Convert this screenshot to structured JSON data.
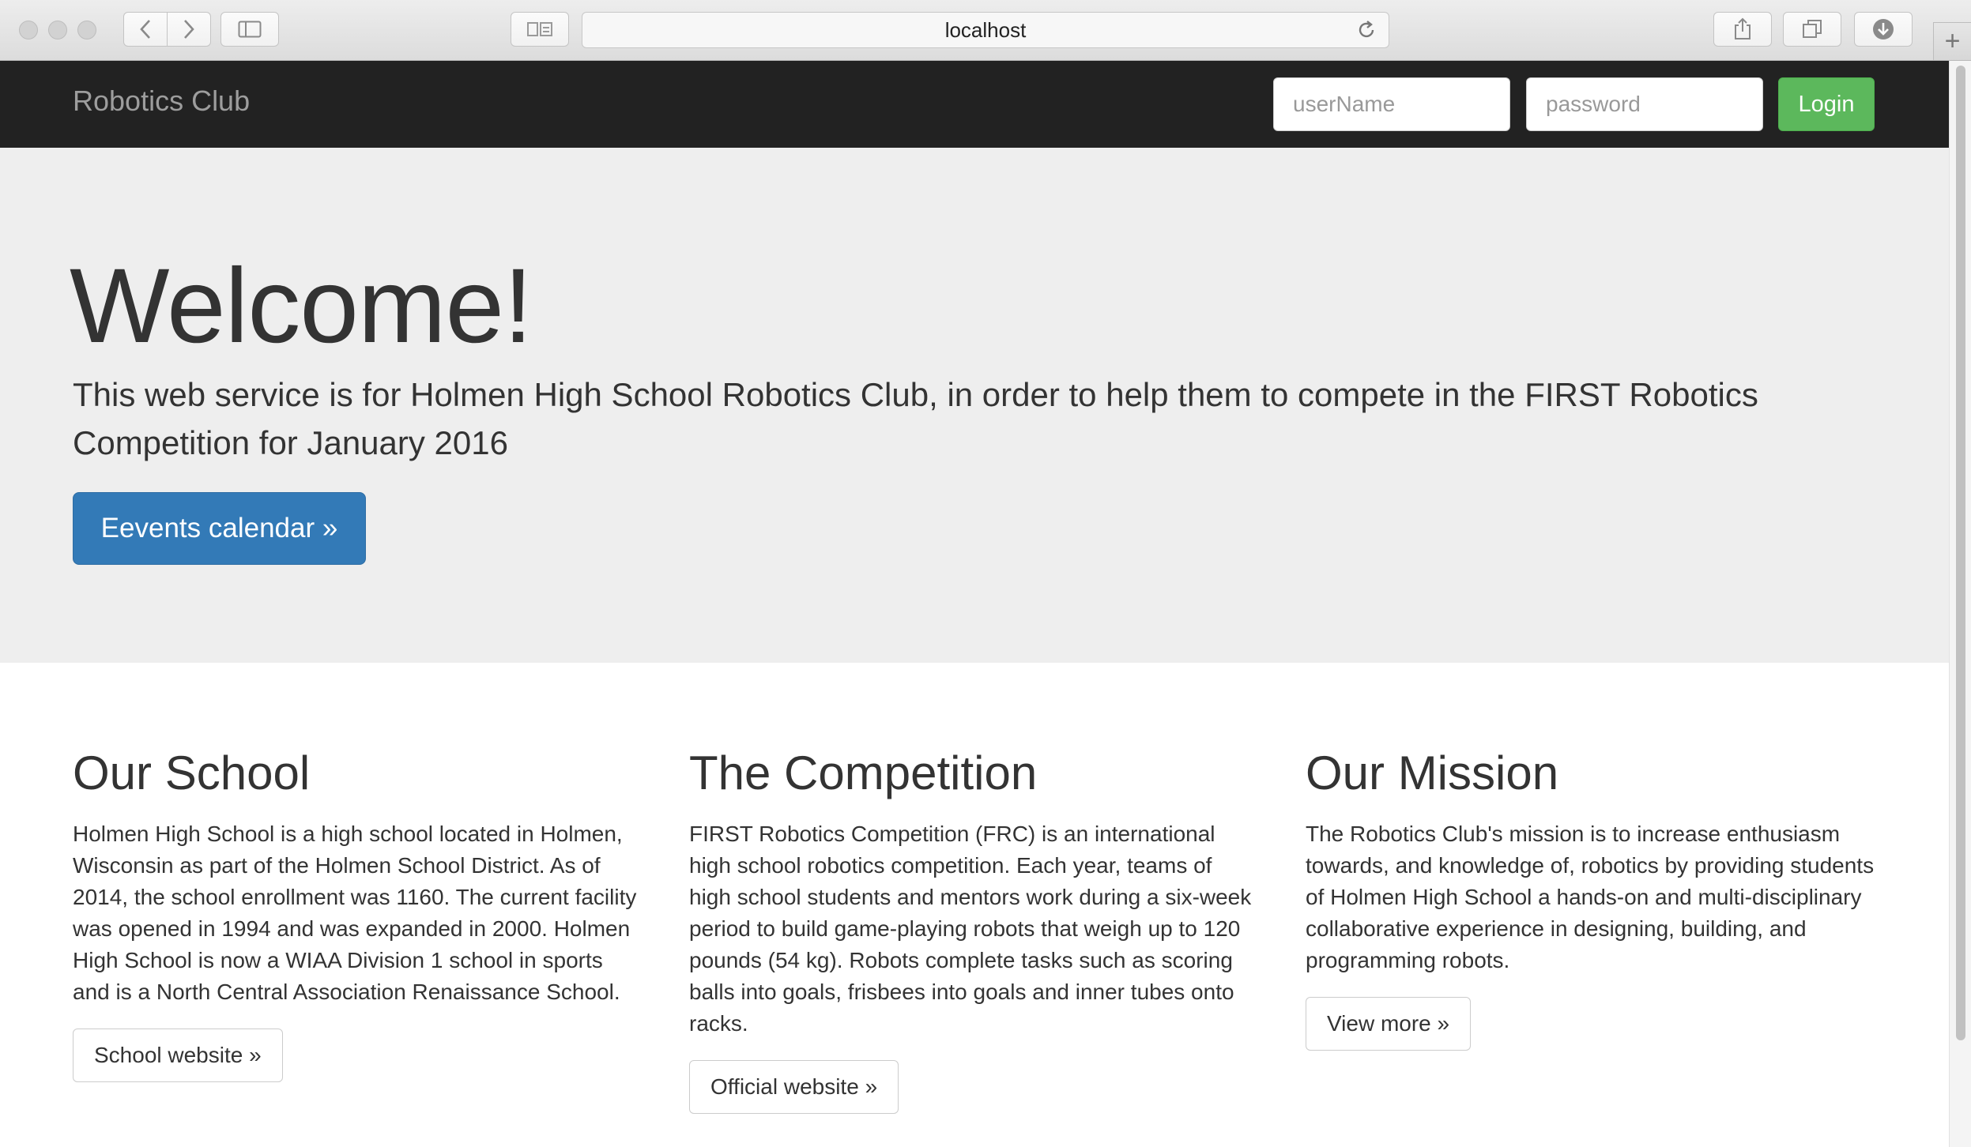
{
  "browser": {
    "url": "localhost",
    "translate_icon": "translate-icon",
    "colors": {
      "chrome": "#dcdcdc"
    }
  },
  "navbar": {
    "brand": "Robotics Club",
    "username_placeholder": "userName",
    "password_placeholder": "password",
    "login_label": "Login",
    "colors": {
      "background": "#222222",
      "login": "#5cb85c"
    }
  },
  "jumbotron": {
    "title": "Welcome!",
    "lead": "This web service is for Holmen High School Robotics Club, in order to help them to compete in the FIRST Robotics Competition for January 2016",
    "button_label": "Eevents calendar »",
    "colors": {
      "background": "#eeeeee",
      "button": "#337ab7"
    }
  },
  "columns": [
    {
      "heading": "Our School",
      "body": "Holmen High School is a high school located in Holmen, Wisconsin as part of the Holmen School District. As of 2014, the school enrollment was 1160. The current facility was opened in 1994 and was expanded in 2000. Holmen High School is now a WIAA Division 1 school in sports and is a North Central Association Renaissance School.",
      "button_label": "School website »"
    },
    {
      "heading": "The Competition",
      "body": "FIRST Robotics Competition (FRC) is an international high school robotics competition. Each year, teams of high school students and mentors work during a six-week period to build game-playing robots that weigh up to 120 pounds (54 kg). Robots complete tasks such as scoring balls into goals, frisbees into goals and inner tubes onto racks.",
      "button_label": "Official website »"
    },
    {
      "heading": "Our Mission",
      "body": "The Robotics Club's mission is to increase enthusiasm towards, and knowledge of, robotics by providing students of Holmen High School a hands-on and multi-disciplinary collaborative experience in designing, building, and programming robots.",
      "button_label": "View more »"
    }
  ]
}
